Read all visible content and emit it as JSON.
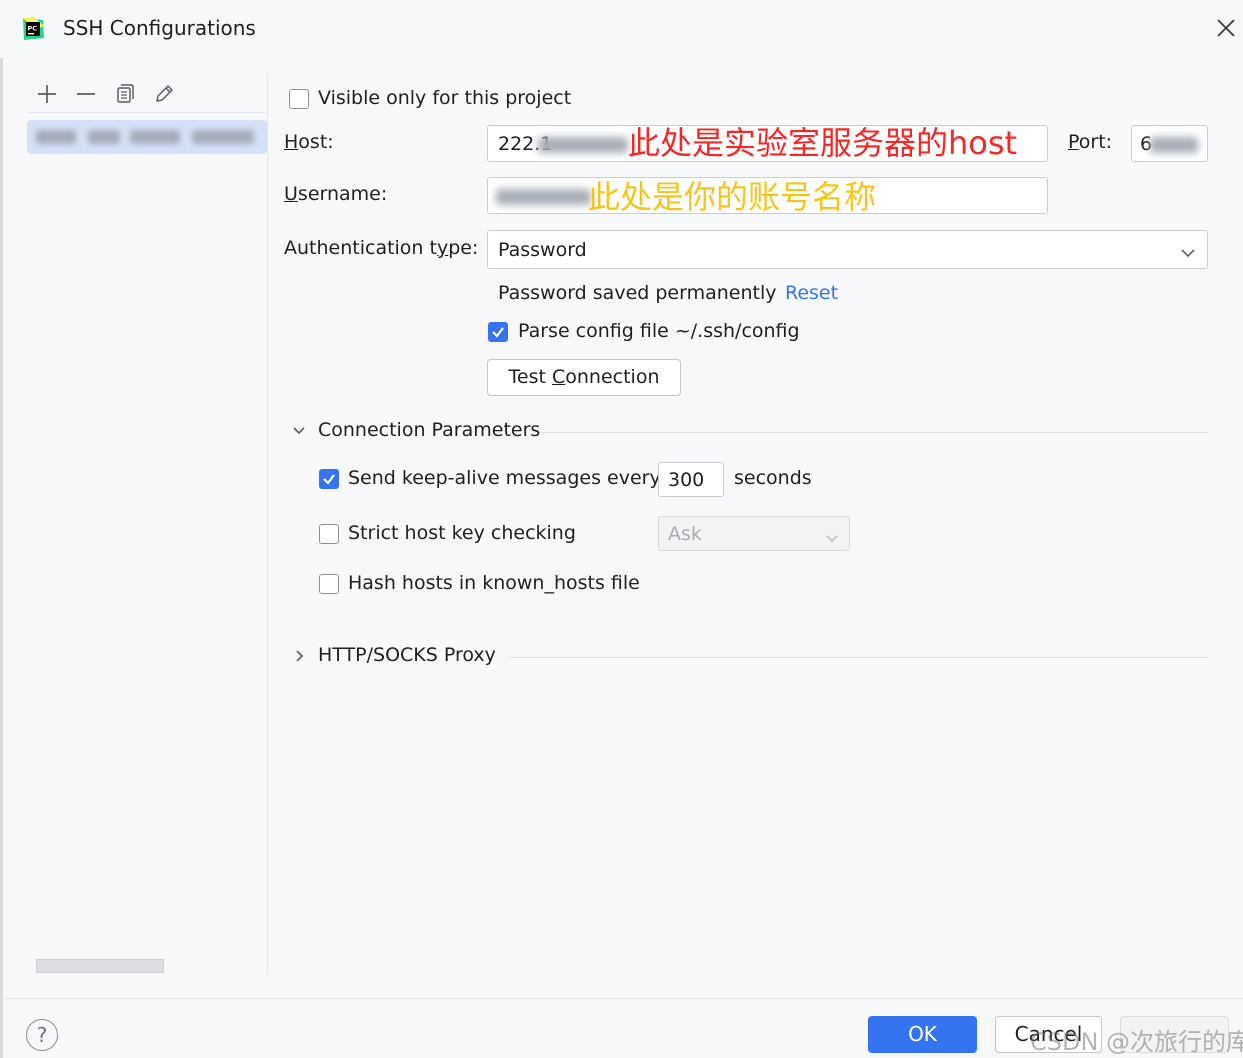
{
  "window": {
    "title": "SSH Configurations",
    "app_icon": "pycharm-logo-icon",
    "app_icon_text": "PC"
  },
  "left_panel": {
    "toolbar_icons": [
      "plus-icon",
      "minus-icon",
      "copy-icon",
      "edit-pencil-icon"
    ]
  },
  "form": {
    "visible_only_label": "Visible only for this project",
    "visible_only_checked": false,
    "host_label": "Host:",
    "host_value": "222.1",
    "host_annotation": "此处是实验室服务器的host",
    "port_label": "Port:",
    "port_value": "6",
    "username_label": "Username:",
    "username_annotation": "此处是你的账号名称",
    "auth_type_label": "Authentication type:",
    "auth_type_value": "Password",
    "password_status": "Password saved permanently",
    "reset_link": "Reset",
    "parse_config_label": "Parse config file ~/.ssh/config",
    "parse_config_checked": true,
    "test_connection_button": "Test Connection"
  },
  "connection_parameters": {
    "title": "Connection Parameters",
    "expanded": true,
    "keepalive_label": "Send keep-alive messages every",
    "keepalive_checked": true,
    "keepalive_value": "300",
    "keepalive_unit": "seconds",
    "strict_host_label": "Strict host key checking",
    "strict_host_checked": false,
    "strict_host_option": "Ask",
    "hash_hosts_label": "Hash hosts in known_hosts file",
    "hash_hosts_checked": false
  },
  "proxy_section": {
    "title": "HTTP/SOCKS Proxy",
    "expanded": false
  },
  "footer": {
    "help": "?",
    "ok": "OK",
    "cancel": "Cancel",
    "watermark": "CSDN @次旅行的库"
  },
  "colors": {
    "accent": "#3574f0",
    "annotation_red": "#f52727",
    "annotation_yellow": "#f5c51b",
    "background": "#f7f8fa"
  }
}
